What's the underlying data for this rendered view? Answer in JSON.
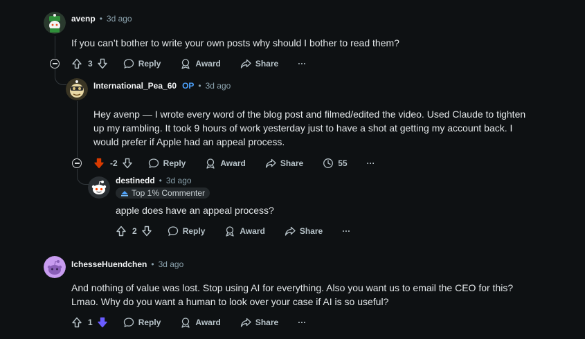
{
  "comments": [
    {
      "username": "avenp",
      "time": "3d ago",
      "body": "If you can’t bother to write your own posts why should I bother to read them?",
      "score": "3",
      "reply_label": "Reply",
      "award_label": "Award",
      "share_label": "Share",
      "more_label": "···"
    },
    {
      "username": "International_Pea_60",
      "op_badge": "OP",
      "time": "3d ago",
      "body_line1": "Hey avenp — I wrote every word of the blog post and filmed/edited the video. Used Claude to tighten",
      "body_line2": "up my rambling. It took 9 hours of work yesterday just to have a shot at getting my account back. I",
      "body_line3": "would prefer if Apple had an appeal process.",
      "score": "-2",
      "reply_label": "Reply",
      "award_label": "Award",
      "share_label": "Share",
      "insights_count": "55",
      "more_label": "···"
    },
    {
      "username": "destinedd",
      "time": "3d ago",
      "flair": "Top 1% Commenter",
      "body": "apple does have an appeal process?",
      "score": "2",
      "reply_label": "Reply",
      "award_label": "Award",
      "share_label": "Share",
      "more_label": "···"
    },
    {
      "username": "IchesseHuendchen",
      "time": "3d ago",
      "body_line1": "And nothing of value was lost. Stop using AI for everything. Also you want us to email the CEO for this?",
      "body_line2": "Lmao. Why do you want a human to look over your case if AI is so useful?",
      "score": "1",
      "reply_label": "Reply",
      "award_label": "Award",
      "share_label": "Share",
      "more_label": "···"
    }
  ],
  "colors": {
    "downvoted": "#d93a00",
    "upvoted_purple": "#6a5cff",
    "op": "#4da3ff"
  },
  "icons": [
    "upvote-icon",
    "downvote-icon",
    "reply-icon",
    "award-icon",
    "share-icon",
    "insights-icon",
    "collapse-icon"
  ]
}
